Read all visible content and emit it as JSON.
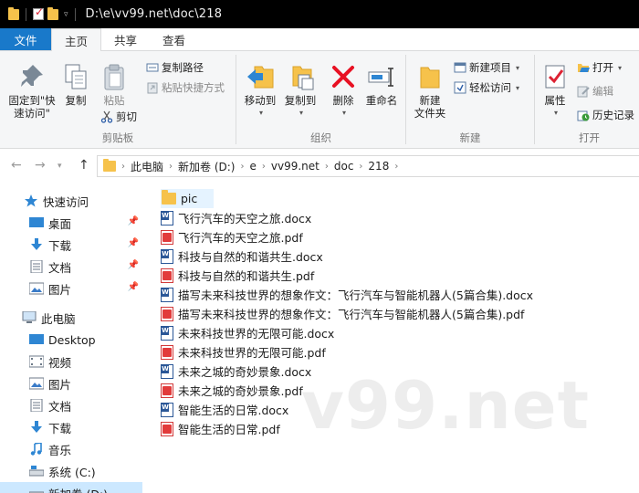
{
  "titlebar": {
    "path": "D:\\e\\vv99.net\\doc\\218"
  },
  "tabs": [
    {
      "label": "文件"
    },
    {
      "label": "主页"
    },
    {
      "label": "共享"
    },
    {
      "label": "查看"
    }
  ],
  "ribbon": {
    "clipboard": {
      "pin": "固定到\"快\n速访问\"",
      "copy": "复制",
      "paste": "粘贴",
      "copy_path": "复制路径",
      "paste_shortcut": "粘贴快捷方式",
      "cut": "剪切",
      "label": "剪贴板"
    },
    "organize": {
      "move_to": "移动到",
      "copy_to": "复制到",
      "delete": "删除",
      "rename": "重命名",
      "label": "组织"
    },
    "new": {
      "new_folder": "新建\n文件夹",
      "new_item": "新建项目",
      "easy_access": "轻松访问",
      "label": "新建"
    },
    "open": {
      "properties": "属性",
      "open": "打开",
      "edit": "编辑",
      "history": "历史记录",
      "label": "打开"
    }
  },
  "address": {
    "crumbs": [
      "此电脑",
      "新加卷 (D:)",
      "e",
      "vv99.net",
      "doc",
      "218"
    ]
  },
  "sidebar": {
    "items": [
      {
        "label": "快速访问"
      },
      {
        "label": "桌面"
      },
      {
        "label": "下载"
      },
      {
        "label": "文档"
      },
      {
        "label": "图片"
      },
      {
        "label": "此电脑"
      },
      {
        "label": "Desktop"
      },
      {
        "label": "视频"
      },
      {
        "label": "图片"
      },
      {
        "label": "文档"
      },
      {
        "label": "下载"
      },
      {
        "label": "音乐"
      },
      {
        "label": "系统 (C:)"
      },
      {
        "label": "新加卷 (D:)"
      }
    ]
  },
  "files": [
    {
      "name": "pic",
      "type": "folder"
    },
    {
      "name": "飞行汽车的天空之旅.docx",
      "type": "docx"
    },
    {
      "name": "飞行汽车的天空之旅.pdf",
      "type": "pdf"
    },
    {
      "name": "科技与自然的和谐共生.docx",
      "type": "docx"
    },
    {
      "name": "科技与自然的和谐共生.pdf",
      "type": "pdf"
    },
    {
      "name": "描写未来科技世界的想象作文：飞行汽车与智能机器人(5篇合集).docx",
      "type": "docx"
    },
    {
      "name": "描写未来科技世界的想象作文：飞行汽车与智能机器人(5篇合集).pdf",
      "type": "pdf"
    },
    {
      "name": "未来科技世界的无限可能.docx",
      "type": "docx"
    },
    {
      "name": "未来科技世界的无限可能.pdf",
      "type": "pdf"
    },
    {
      "name": "未来之城的奇妙景象.docx",
      "type": "docx"
    },
    {
      "name": "未来之城的奇妙景象.pdf",
      "type": "pdf"
    },
    {
      "name": "智能生活的日常.docx",
      "type": "docx"
    },
    {
      "name": "智能生活的日常.pdf",
      "type": "pdf"
    }
  ],
  "watermark": "v99.net",
  "colors": {
    "file_tab": "#1979ca",
    "folder": "#f6c24b",
    "word": "#2b5797",
    "pdf": "#e23b3b",
    "delete": "#e81123"
  }
}
